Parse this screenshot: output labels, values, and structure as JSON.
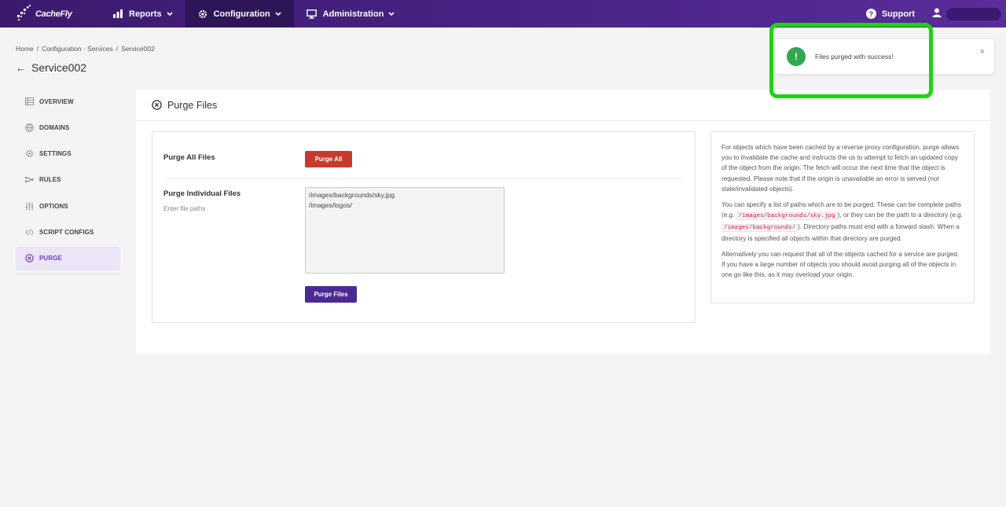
{
  "brand": {
    "name": "CacheFly"
  },
  "nav": {
    "items": [
      {
        "label": "Reports",
        "icon": "bar-chart-icon"
      },
      {
        "label": "Configuration",
        "icon": "gear-icon",
        "active": true
      },
      {
        "label": "Administration",
        "icon": "monitor-icon"
      }
    ],
    "support_label": "Support"
  },
  "breadcrumb": {
    "home": "Home",
    "section": "Configuration - Services",
    "current": "Service002"
  },
  "page_title": "Service002",
  "sidebar": {
    "items": [
      {
        "label": "OVERVIEW",
        "icon": "grid-icon"
      },
      {
        "label": "DOMAINS",
        "icon": "globe-icon"
      },
      {
        "label": "SETTINGS",
        "icon": "gear-icon"
      },
      {
        "label": "RULES",
        "icon": "flow-icon"
      },
      {
        "label": "OPTIONS",
        "icon": "sliders-icon"
      },
      {
        "label": "SCRIPT CONFIGS",
        "icon": "code-icon"
      },
      {
        "label": "PURGE",
        "icon": "x-circle-icon",
        "active": true
      }
    ]
  },
  "card": {
    "title": "Purge Files",
    "purge_all_label": "Purge All Files",
    "purge_all_button": "Purge All",
    "purge_individual_label": "Purge Individual Files",
    "purge_individual_hint": "Enter file paths",
    "paths_value": "/images/backgrounds/sky.jpg\n/images/logos/",
    "purge_files_button": "Purge Files"
  },
  "info": {
    "p1": "For objects which have been cached by a reverse proxy configuration, purge allows you to invalidate the cache and instructs the us to attempt to fetch an updated copy of the object from the origin. The fetch will occur the next time that the object is requested. Please note that if the origin is unavailable an error is served (not stale/invalidated objects).",
    "p2_a": "You can specify a list of paths which are to be purged. These can be complete paths (e.g. ",
    "p2_code1": "/images/backgrounds/sky.jpg",
    "p2_b": "), or they can be the path to a directory (e.g. ",
    "p2_code2": "/images/backgrounds/",
    "p2_c": "). Directory paths must end with a forward slash. When a directory is specified all objects within that directory are purged.",
    "p3": "Alternatively you can request that all of the objects cached for a service are purged. If you have a large number of objects you should avoid purging all of the objects in one go like this, as it may overload your origin."
  },
  "toast": {
    "message": "Files purged with success!",
    "icon": "exclamation-icon",
    "close": "×"
  },
  "colors": {
    "nav": "#4b2588",
    "accent": "#6a3fb0",
    "danger": "#c93a2e",
    "success": "#2fa84f",
    "highlight": "#1ed40e"
  }
}
